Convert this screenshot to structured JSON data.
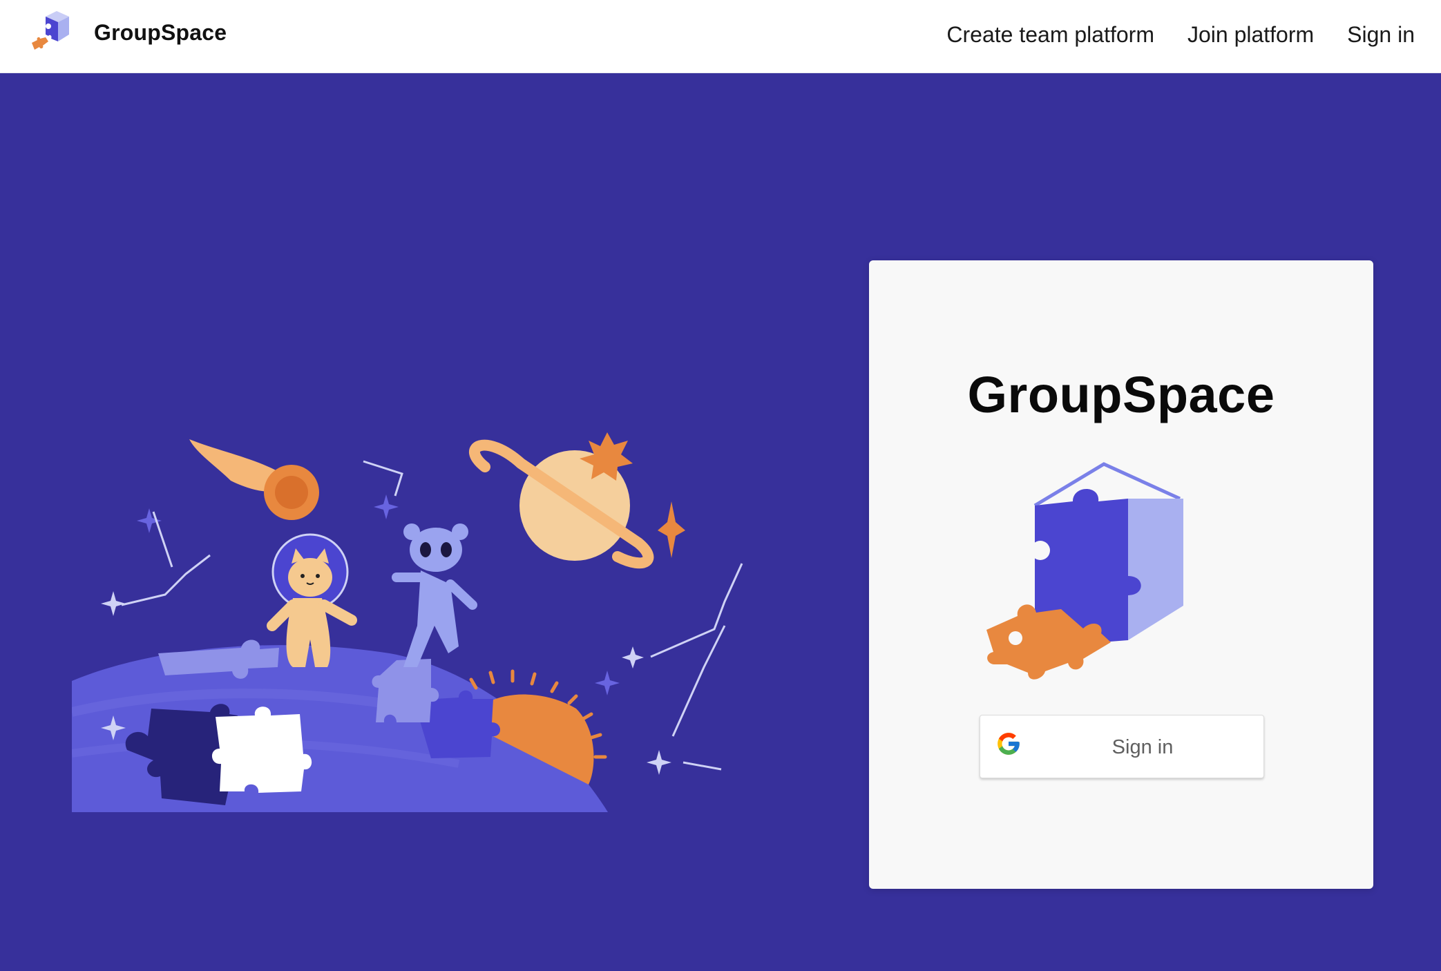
{
  "header": {
    "brand_name": "GroupSpace",
    "nav": {
      "create_team_platform": "Create team platform",
      "join_platform": "Join platform",
      "sign_in": "Sign in"
    }
  },
  "hero": {
    "background_color": "#37309b",
    "illustration_icon": "space-puzzle-illustration"
  },
  "login_card": {
    "title": "GroupSpace",
    "logo_icon": "puzzle-cube-icon",
    "google_button": {
      "label": "Sign in",
      "icon": "google-g-icon"
    }
  },
  "colors": {
    "accent_orange": "#e8883f",
    "accent_blue": "#4b45d0",
    "light_blue": "#9aa3ef",
    "peach": "#f5c98f"
  }
}
